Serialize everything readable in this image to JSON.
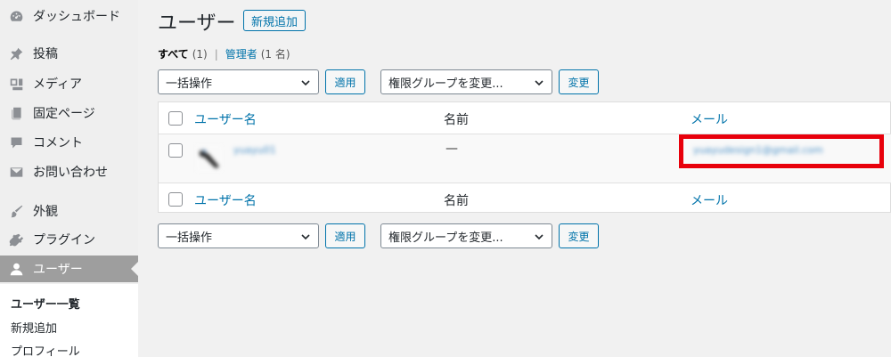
{
  "sidebar": {
    "items": [
      {
        "label": "ダッシュボード",
        "icon": "dashboard-icon"
      },
      {
        "label": "投稿",
        "icon": "pushpin-icon"
      },
      {
        "label": "メディア",
        "icon": "media-icon"
      },
      {
        "label": "固定ページ",
        "icon": "page-icon"
      },
      {
        "label": "コメント",
        "icon": "comment-icon"
      },
      {
        "label": "お問い合わせ",
        "icon": "mail-icon"
      },
      {
        "label": "外観",
        "icon": "brush-icon"
      },
      {
        "label": "プラグイン",
        "icon": "plugin-icon"
      },
      {
        "label": "ユーザー",
        "icon": "user-icon",
        "active": true
      }
    ],
    "submenu": [
      {
        "label": "ユーザー一覧",
        "current": true
      },
      {
        "label": "新規追加"
      },
      {
        "label": "プロフィール"
      }
    ]
  },
  "header": {
    "title": "ユーザー",
    "add_new_label": "新規追加"
  },
  "views": {
    "all_label": "すべて",
    "all_count": "(1)",
    "separator": "|",
    "admin_label": "管理者",
    "admin_count": "(1 名)"
  },
  "tablenav_top": {
    "bulk_select": "一括操作",
    "apply_label": "適用",
    "role_select": "権限グループを変更...",
    "change_label": "変更"
  },
  "tablenav_bottom": {
    "bulk_select": "一括操作",
    "apply_label": "適用",
    "role_select": "権限グループを変更...",
    "change_label": "変更"
  },
  "table": {
    "columns": [
      "ユーザー名",
      "名前",
      "メール"
    ],
    "rows": [
      {
        "username": "yuayu01",
        "name": "—",
        "email": "yuayudesign1@gmail.com"
      }
    ]
  },
  "colors": {
    "link": "#0073aa",
    "highlight": "#e8000b",
    "active_menu": "#9e9e9e"
  }
}
